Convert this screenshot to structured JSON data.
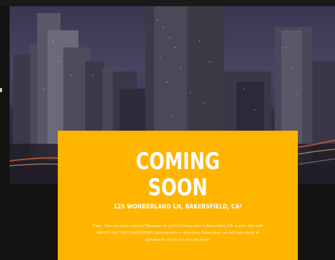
{
  "hero": {
    "scene": "night-city-skyline"
  },
  "card": {
    "headline_line1": "COMING",
    "headline_line2": "SOON",
    "address": "125 WONDERLAND LN, BAKERSFIELD, CA!",
    "body": "Psst... Can you keep a secret? Because we can't! Coming soon in Bakersfield, CA, is your very own WACKY FACTORY EMPORIUM! Opening soon in downtown Bakersfield, we will have plenty of activities for you to try! See you there!",
    "color": "#ffb500"
  }
}
